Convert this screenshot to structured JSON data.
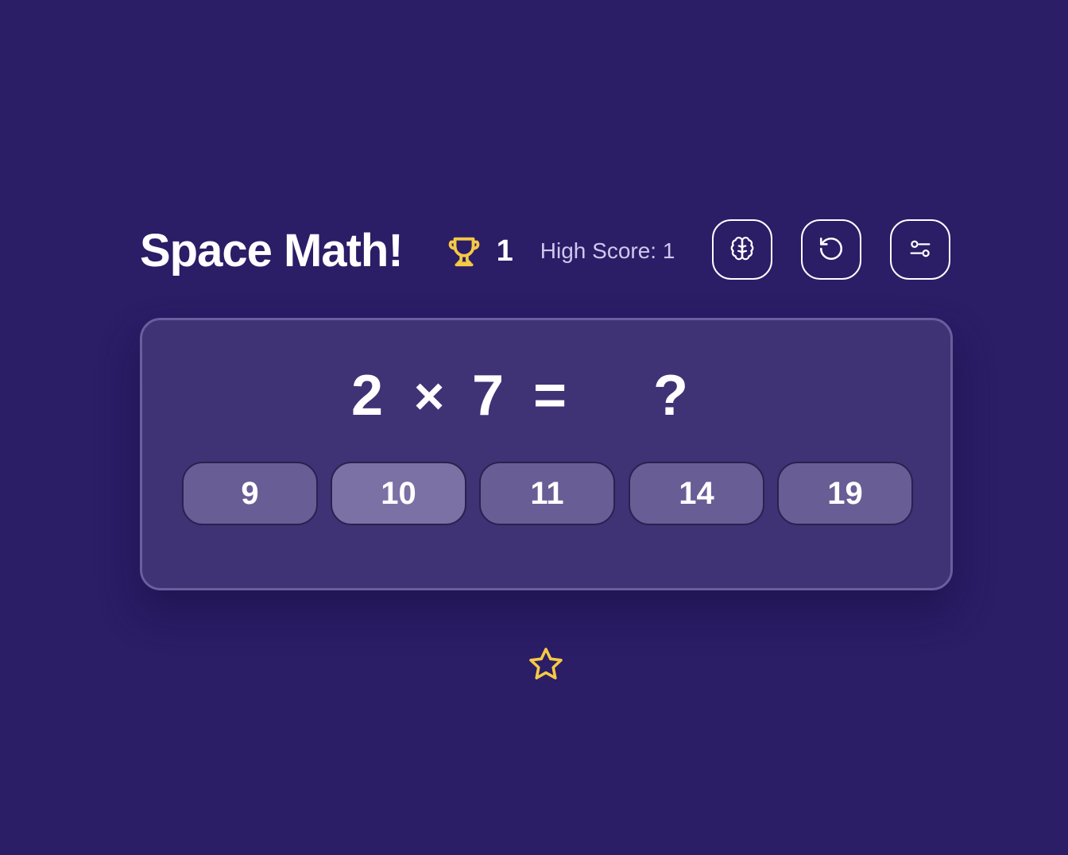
{
  "header": {
    "title": "Space Math!",
    "score": "1",
    "high_score_label": "High Score: 1"
  },
  "icons": {
    "trophy": "trophy-icon",
    "brain": "brain-icon",
    "reset": "rotate-ccw-icon",
    "settings": "sliders-icon",
    "star": "star-icon"
  },
  "question": {
    "operand_a": "2",
    "operator": "×",
    "operand_b": "7",
    "equals": "=",
    "answer_placeholder": "?"
  },
  "answers": [
    "9",
    "10",
    "11",
    "14",
    "19"
  ],
  "colors": {
    "background": "#2b1d66",
    "card": "#3f3275",
    "card_border": "#6a5e9e",
    "answer_button": "#695d96",
    "answer_button_hover": "#7b71a4",
    "accent_gold": "#f5c945",
    "muted_text": "#cfc8ee"
  }
}
